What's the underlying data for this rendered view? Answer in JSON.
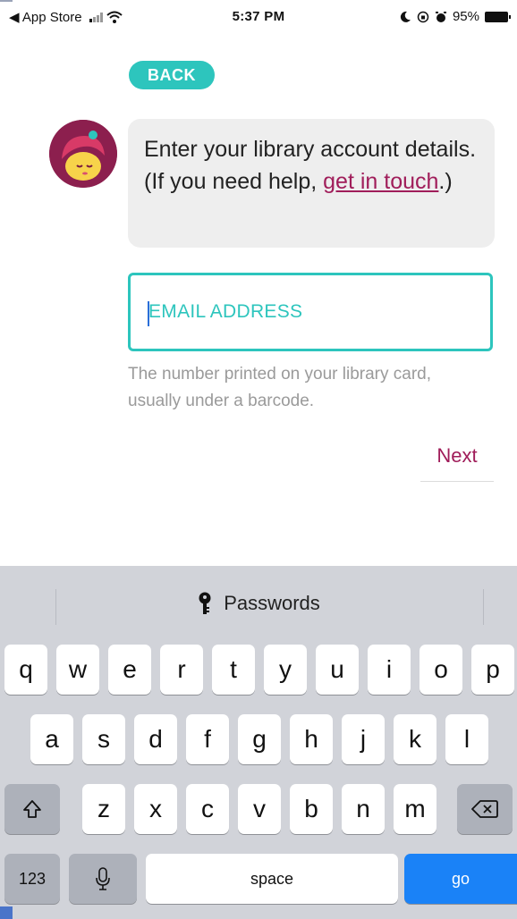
{
  "status_bar": {
    "back_app": "◀ App Store",
    "time": "5:37 PM",
    "battery": "95%"
  },
  "back_button": "BACK",
  "message": {
    "text_before": "Enter your library account details. (If you need help, ",
    "link": "get in touch",
    "text_after": ".)"
  },
  "email_field": {
    "placeholder": "EMAIL ADDRESS",
    "value": ""
  },
  "helper_text": "The number printed on your library card, usually under a barcode.",
  "next_button": "Next",
  "colors": {
    "accent": "#2dc5bd",
    "link": "#a01d5a",
    "go_key": "#1a82f7"
  },
  "keyboard": {
    "suggestion": "Passwords",
    "row1": [
      "q",
      "w",
      "e",
      "r",
      "t",
      "y",
      "u",
      "i",
      "o",
      "p"
    ],
    "row2": [
      "a",
      "s",
      "d",
      "f",
      "g",
      "h",
      "j",
      "k",
      "l"
    ],
    "row3": [
      "z",
      "x",
      "c",
      "v",
      "b",
      "n",
      "m"
    ],
    "numbers_key": "123",
    "space_key": "space",
    "go_key": "go",
    "icons": {
      "shift": "shift-icon",
      "delete": "delete-icon",
      "mic": "microphone-icon",
      "key": "key-icon"
    }
  }
}
